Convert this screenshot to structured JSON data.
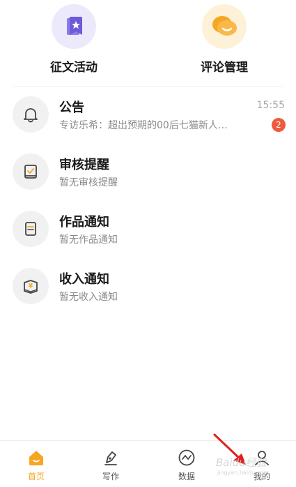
{
  "top_actions": [
    {
      "label": "征文活动",
      "icon": "bookmark-star-icon",
      "bg": "#ece9fb",
      "color": "#6b5bd8"
    },
    {
      "label": "评论管理",
      "icon": "chat-bubble-icon",
      "bg": "#fdf1d8",
      "color": "#f6a623"
    }
  ],
  "messages": [
    {
      "title": "公告",
      "subtitle": "专访乐希：超出预期的00后七猫新人…",
      "time": "15:55",
      "badge": "2",
      "icon": "bell-icon"
    },
    {
      "title": "审核提醒",
      "subtitle": "暂无审核提醒",
      "icon": "review-book-icon"
    },
    {
      "title": "作品通知",
      "subtitle": "暂无作品通知",
      "icon": "document-icon"
    },
    {
      "title": "收入通知",
      "subtitle": "暂无收入通知",
      "icon": "income-yen-icon"
    }
  ],
  "tabbar": {
    "active": "首页",
    "accent_color": "#f6a623",
    "items": [
      {
        "label": "首页",
        "icon": "home-icon"
      },
      {
        "label": "写作",
        "icon": "pen-icon"
      },
      {
        "label": "数据",
        "icon": "chart-icon"
      },
      {
        "label": "我的",
        "icon": "user-icon"
      }
    ]
  },
  "watermark": {
    "text": "Baidu经验",
    "sub": "jingyan.baidu.com"
  }
}
